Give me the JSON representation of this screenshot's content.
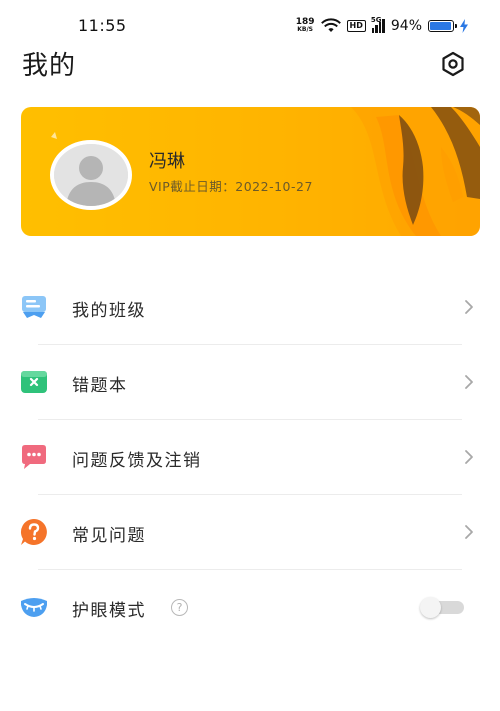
{
  "status_bar": {
    "time": "11:55",
    "net_speed": "189",
    "net_speed_unit": "KB/S",
    "hd_label": "HD",
    "network_type": "5G",
    "battery_percent": "94%",
    "battery_level": 0.94
  },
  "header": {
    "title": "我的",
    "settings_icon": "settings-hexagon-icon"
  },
  "profile": {
    "name": "冯琳",
    "vip_expiry": "VIP截止日期：2022-10-27",
    "card_color": "#ffb400"
  },
  "menu": {
    "items": [
      {
        "label": "我的班级",
        "icon": "class-icon",
        "icon_color": "#5aa9f0"
      },
      {
        "label": "错题本",
        "icon": "wrong-notebook-icon",
        "icon_color": "#2fc27a"
      },
      {
        "label": "问题反馈及注销",
        "icon": "feedback-icon",
        "icon_color": "#f06a7e"
      },
      {
        "label": "常见问题",
        "icon": "faq-icon",
        "icon_color": "#f5742a"
      },
      {
        "label": "护眼模式",
        "icon": "eye-care-icon",
        "icon_color": "#4d9ff0",
        "toggle_on": false
      }
    ],
    "help_mark": "?"
  }
}
